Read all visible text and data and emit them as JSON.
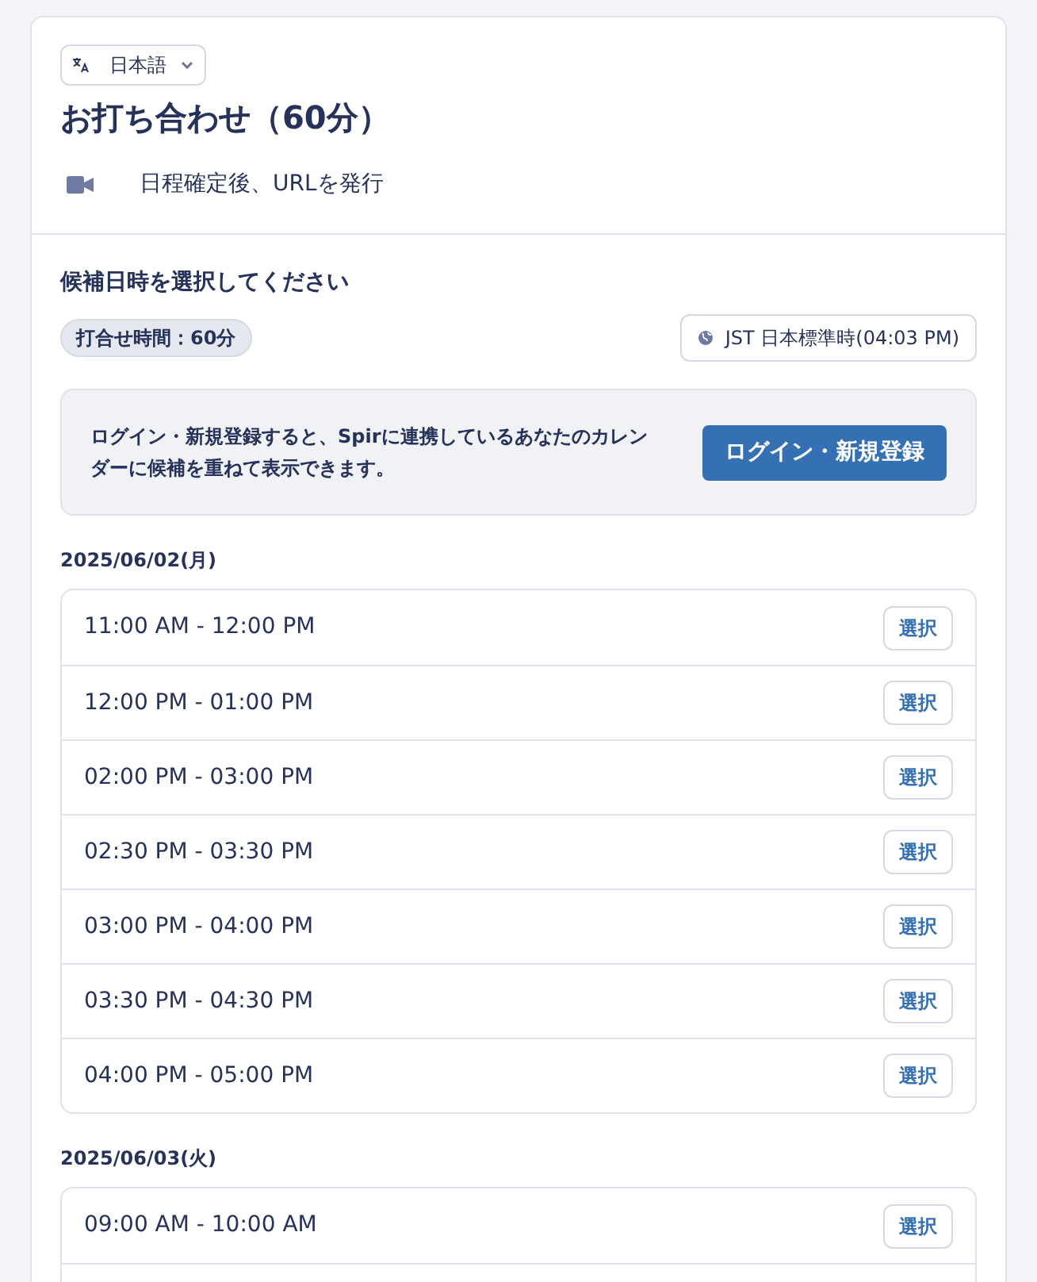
{
  "header": {
    "language": {
      "label": "日本語"
    },
    "title": "お打ち合わせ（60分）",
    "location": "日程確定後、URLを発行"
  },
  "prompt": "候補日時を選択してください",
  "duration_badge": "打合せ時間：60分",
  "timezone": "JST 日本標準時(04:03 PM)",
  "login_banner": {
    "text": "ログイン・新規登録すると、Spirに連携しているあなたのカレンダーに候補を重ねて表示できます。",
    "button": "ログイン・新規登録"
  },
  "days": [
    {
      "date": "2025/06/02(月)",
      "slots": [
        {
          "time": "11:00 AM - 12:00 PM",
          "button": "選択"
        },
        {
          "time": "12:00 PM - 01:00 PM",
          "button": "選択"
        },
        {
          "time": "02:00 PM - 03:00 PM",
          "button": "選択"
        },
        {
          "time": "02:30 PM - 03:30 PM",
          "button": "選択"
        },
        {
          "time": "03:00 PM - 04:00 PM",
          "button": "選択"
        },
        {
          "time": "03:30 PM - 04:30 PM",
          "button": "選択"
        },
        {
          "time": "04:00 PM - 05:00 PM",
          "button": "選択"
        }
      ]
    },
    {
      "date": "2025/06/03(火)",
      "slots": [
        {
          "time": "09:00 AM - 10:00 AM",
          "button": "選択"
        }
      ]
    }
  ]
}
